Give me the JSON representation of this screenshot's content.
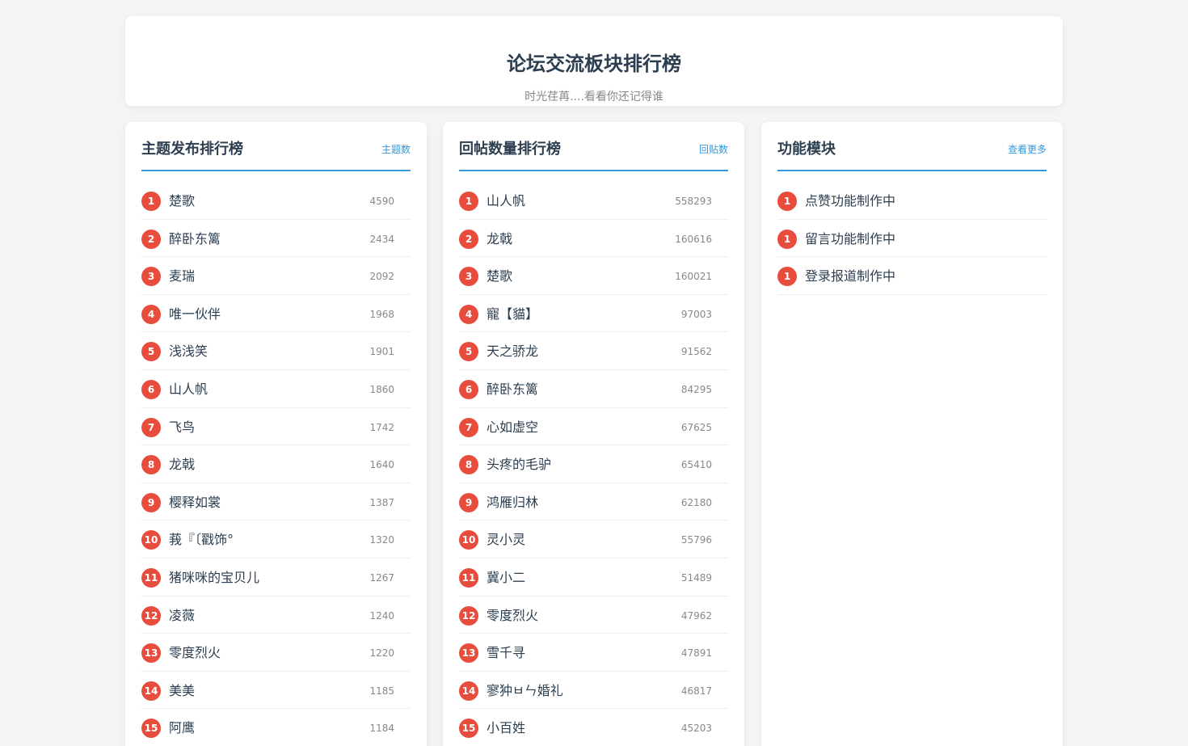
{
  "header": {
    "title": "论坛交流板块排行榜",
    "subtitle": "时光荏苒....看看你还记得谁"
  },
  "colors": {
    "accent": "#3498db",
    "badge": "#e74c3c",
    "title_text": "#2c3e50",
    "muted_text": "#888888",
    "page_background": "#f3f4f5"
  },
  "panels": [
    {
      "title": "主题发布排行榜",
      "link": "主题数",
      "items": [
        {
          "rank": "1",
          "name": "楚歌",
          "count": "4590"
        },
        {
          "rank": "2",
          "name": "醉卧东篱",
          "count": "2434"
        },
        {
          "rank": "3",
          "name": "麦瑞",
          "count": "2092"
        },
        {
          "rank": "4",
          "name": "唯一伙伴",
          "count": "1968"
        },
        {
          "rank": "5",
          "name": "浅浅笑",
          "count": "1901"
        },
        {
          "rank": "6",
          "name": "山人帆",
          "count": "1860"
        },
        {
          "rank": "7",
          "name": "飞鸟",
          "count": "1742"
        },
        {
          "rank": "8",
          "name": "龙戟",
          "count": "1640"
        },
        {
          "rank": "9",
          "name": "樱释如裳",
          "count": "1387"
        },
        {
          "rank": "10",
          "name": "莪『〔戳饰°",
          "count": "1320"
        },
        {
          "rank": "11",
          "name": "猪咪咪的宝贝儿",
          "count": "1267"
        },
        {
          "rank": "12",
          "name": "凌薇",
          "count": "1240"
        },
        {
          "rank": "13",
          "name": "零度烈火",
          "count": "1220"
        },
        {
          "rank": "14",
          "name": "美美",
          "count": "1185"
        },
        {
          "rank": "15",
          "name": "阿鹰",
          "count": "1184"
        }
      ]
    },
    {
      "title": "回帖数量排行榜",
      "link": "回贴数",
      "items": [
        {
          "rank": "1",
          "name": "山人帆",
          "count": "558293"
        },
        {
          "rank": "2",
          "name": "龙戟",
          "count": "160616"
        },
        {
          "rank": "3",
          "name": "楚歌",
          "count": "160021"
        },
        {
          "rank": "4",
          "name": "寵【貓】",
          "count": "97003"
        },
        {
          "rank": "5",
          "name": "天之骄龙",
          "count": "91562"
        },
        {
          "rank": "6",
          "name": "醉卧东篱",
          "count": "84295"
        },
        {
          "rank": "7",
          "name": "心如虚空",
          "count": "67625"
        },
        {
          "rank": "8",
          "name": "头疼的毛驴",
          "count": "65410"
        },
        {
          "rank": "9",
          "name": "鸿雁归林",
          "count": "62180"
        },
        {
          "rank": "10",
          "name": "灵小灵",
          "count": "55796"
        },
        {
          "rank": "11",
          "name": "冀小二",
          "count": "51489"
        },
        {
          "rank": "12",
          "name": "零度烈火",
          "count": "47962"
        },
        {
          "rank": "13",
          "name": "雪千寻",
          "count": "47891"
        },
        {
          "rank": "14",
          "name": "寥狆ㅂㄣ婚礼",
          "count": "46817"
        },
        {
          "rank": "15",
          "name": "小百姓",
          "count": "45203"
        }
      ]
    },
    {
      "title": "功能模块",
      "link": "查看更多",
      "items": [
        {
          "rank": "1",
          "name": "点赞功能制作中",
          "count": ""
        },
        {
          "rank": "1",
          "name": "留言功能制作中",
          "count": ""
        },
        {
          "rank": "1",
          "name": "登录报道制作中",
          "count": ""
        }
      ]
    }
  ]
}
